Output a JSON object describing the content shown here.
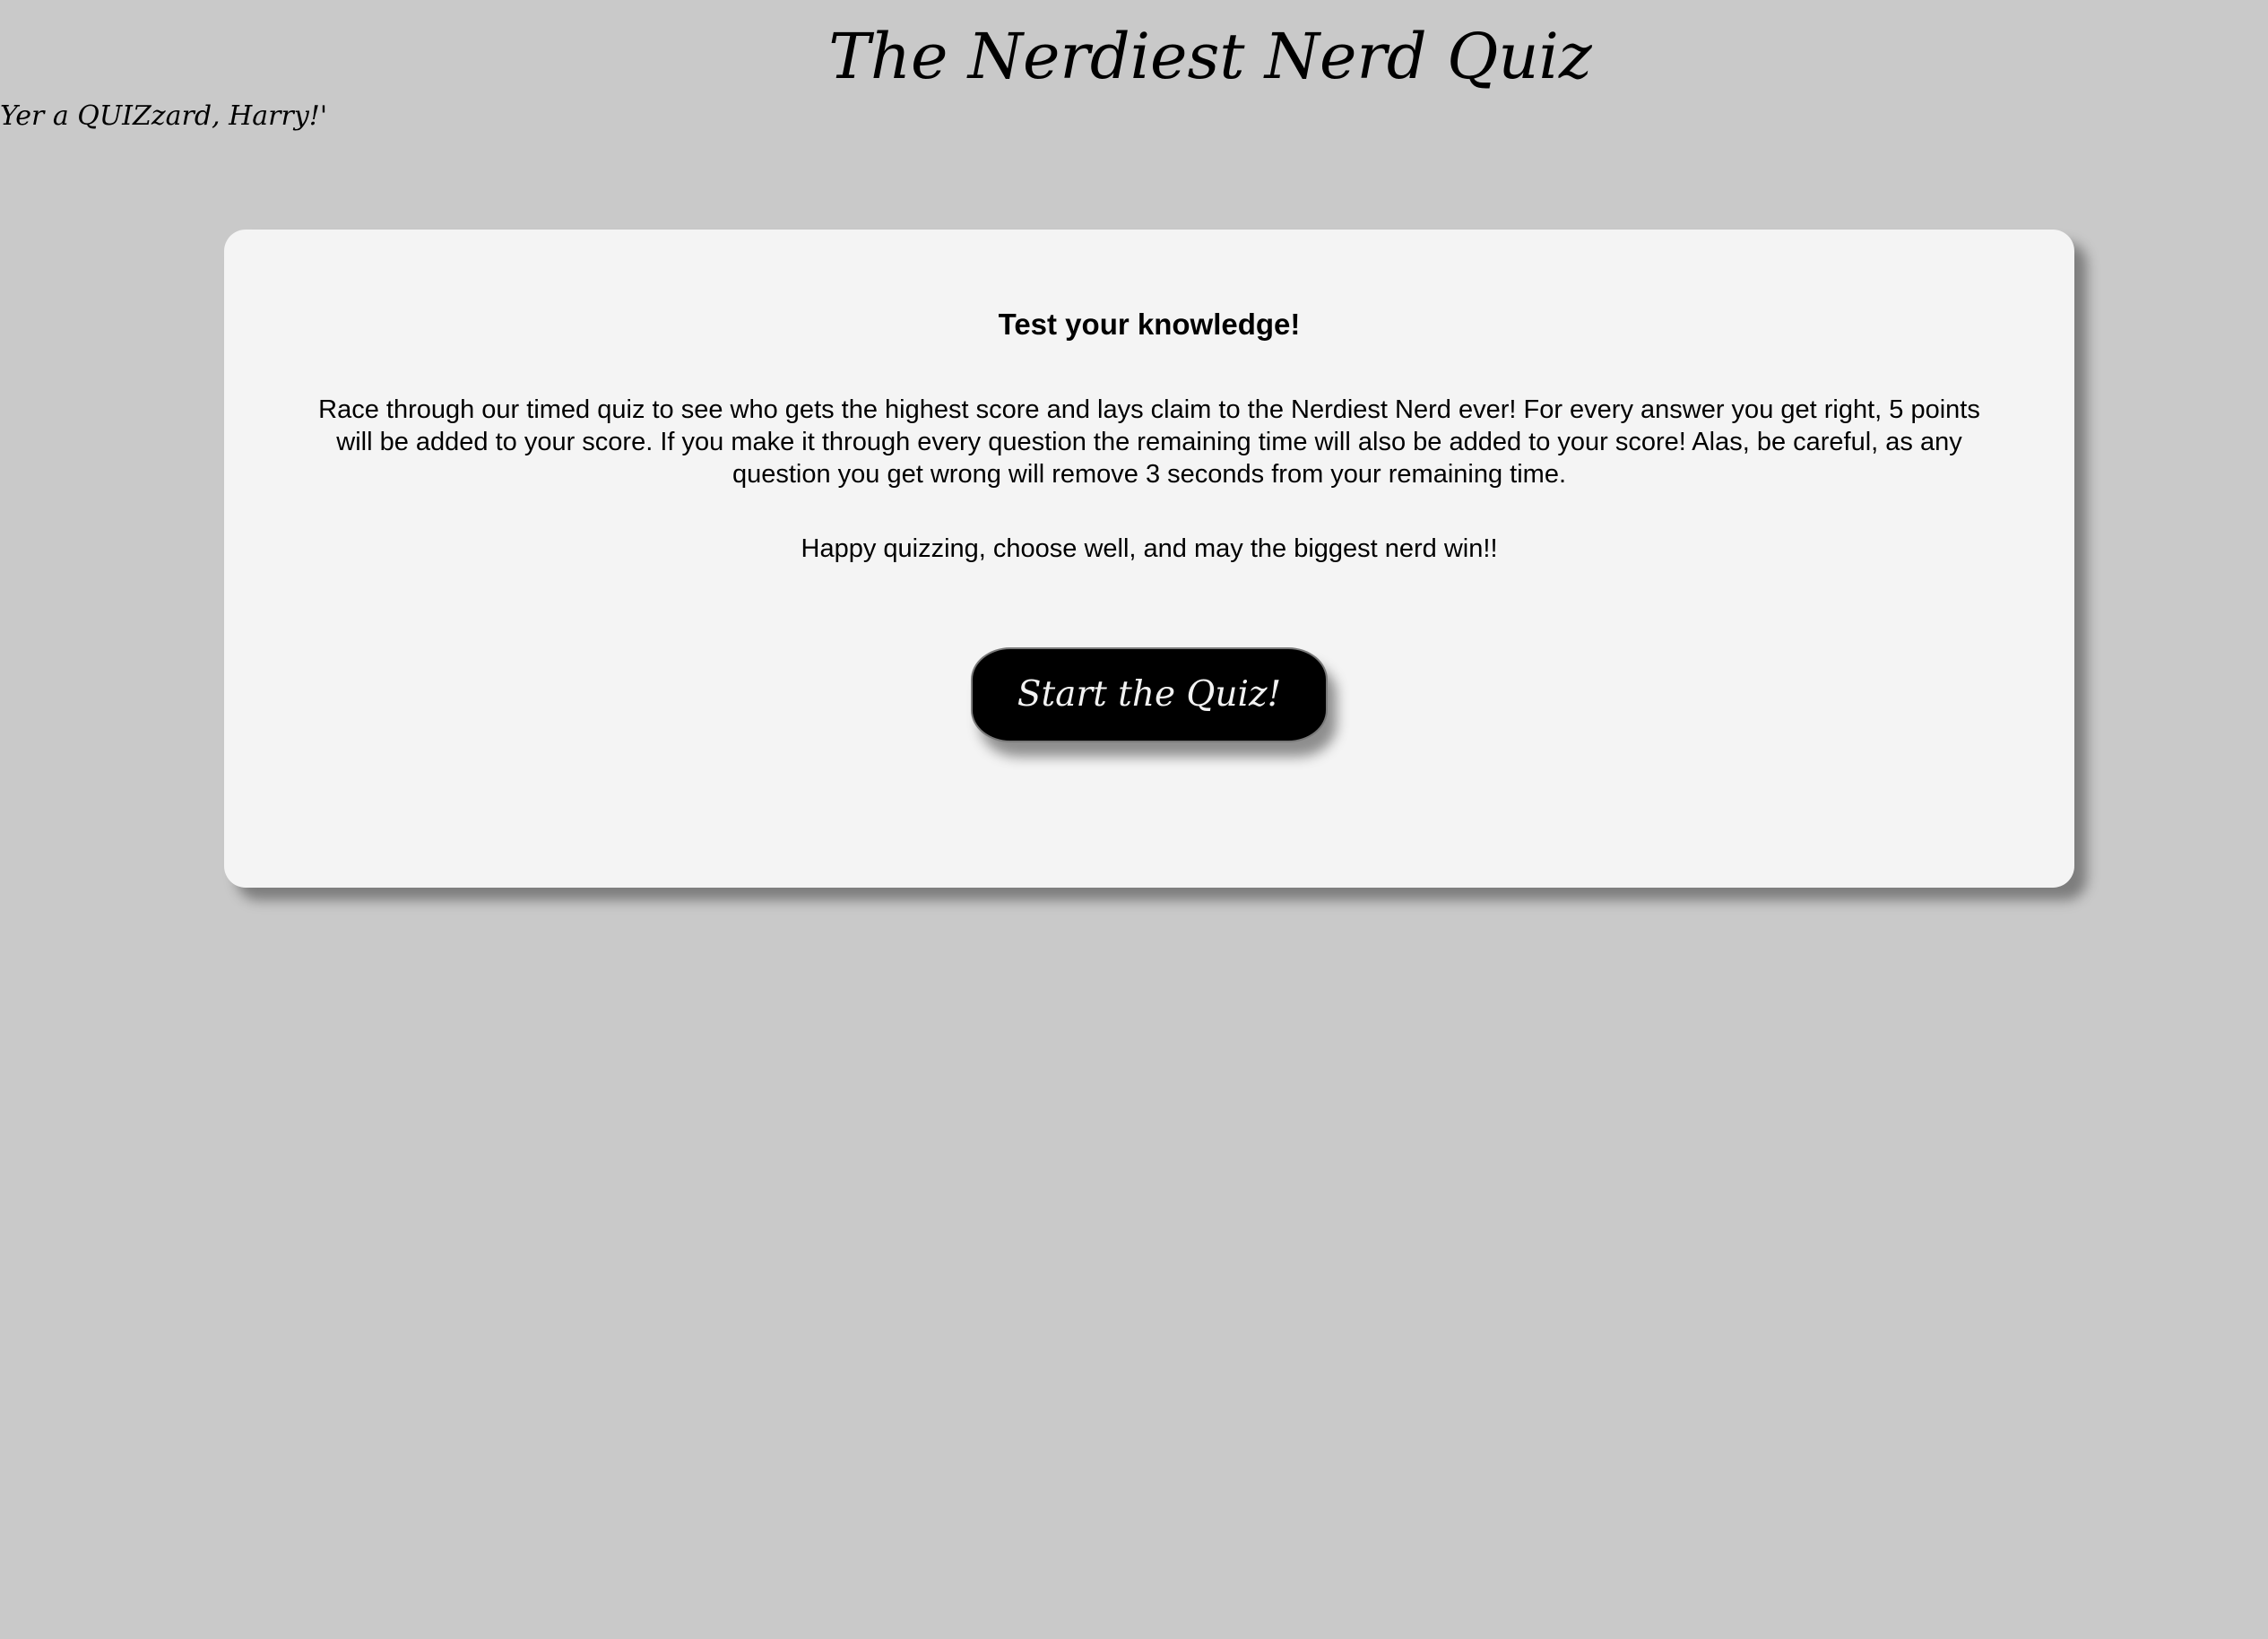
{
  "header": {
    "title": "The Nerdiest Nerd Quiz",
    "tagline": "Yer a QUIZzard, Harry!'"
  },
  "card": {
    "heading": "Test your knowledge!",
    "body": "Race through our timed quiz to see who gets the highest score and lays claim to the Nerdiest Nerd ever! For every answer you get right, 5 points will be added to your score. If you make it through every question the remaining time will also be added to your score! Alas, be careful, as any question you get wrong will remove 3 seconds from your remaining time.",
    "closing": "Happy quizzing, choose well, and may the biggest nerd win!!",
    "start_button_label": "Start the Quiz!"
  },
  "colors": {
    "background": "#c9c9c9",
    "card": "#f4f4f4",
    "button": "#000000",
    "button_text": "#f2f2f2"
  }
}
